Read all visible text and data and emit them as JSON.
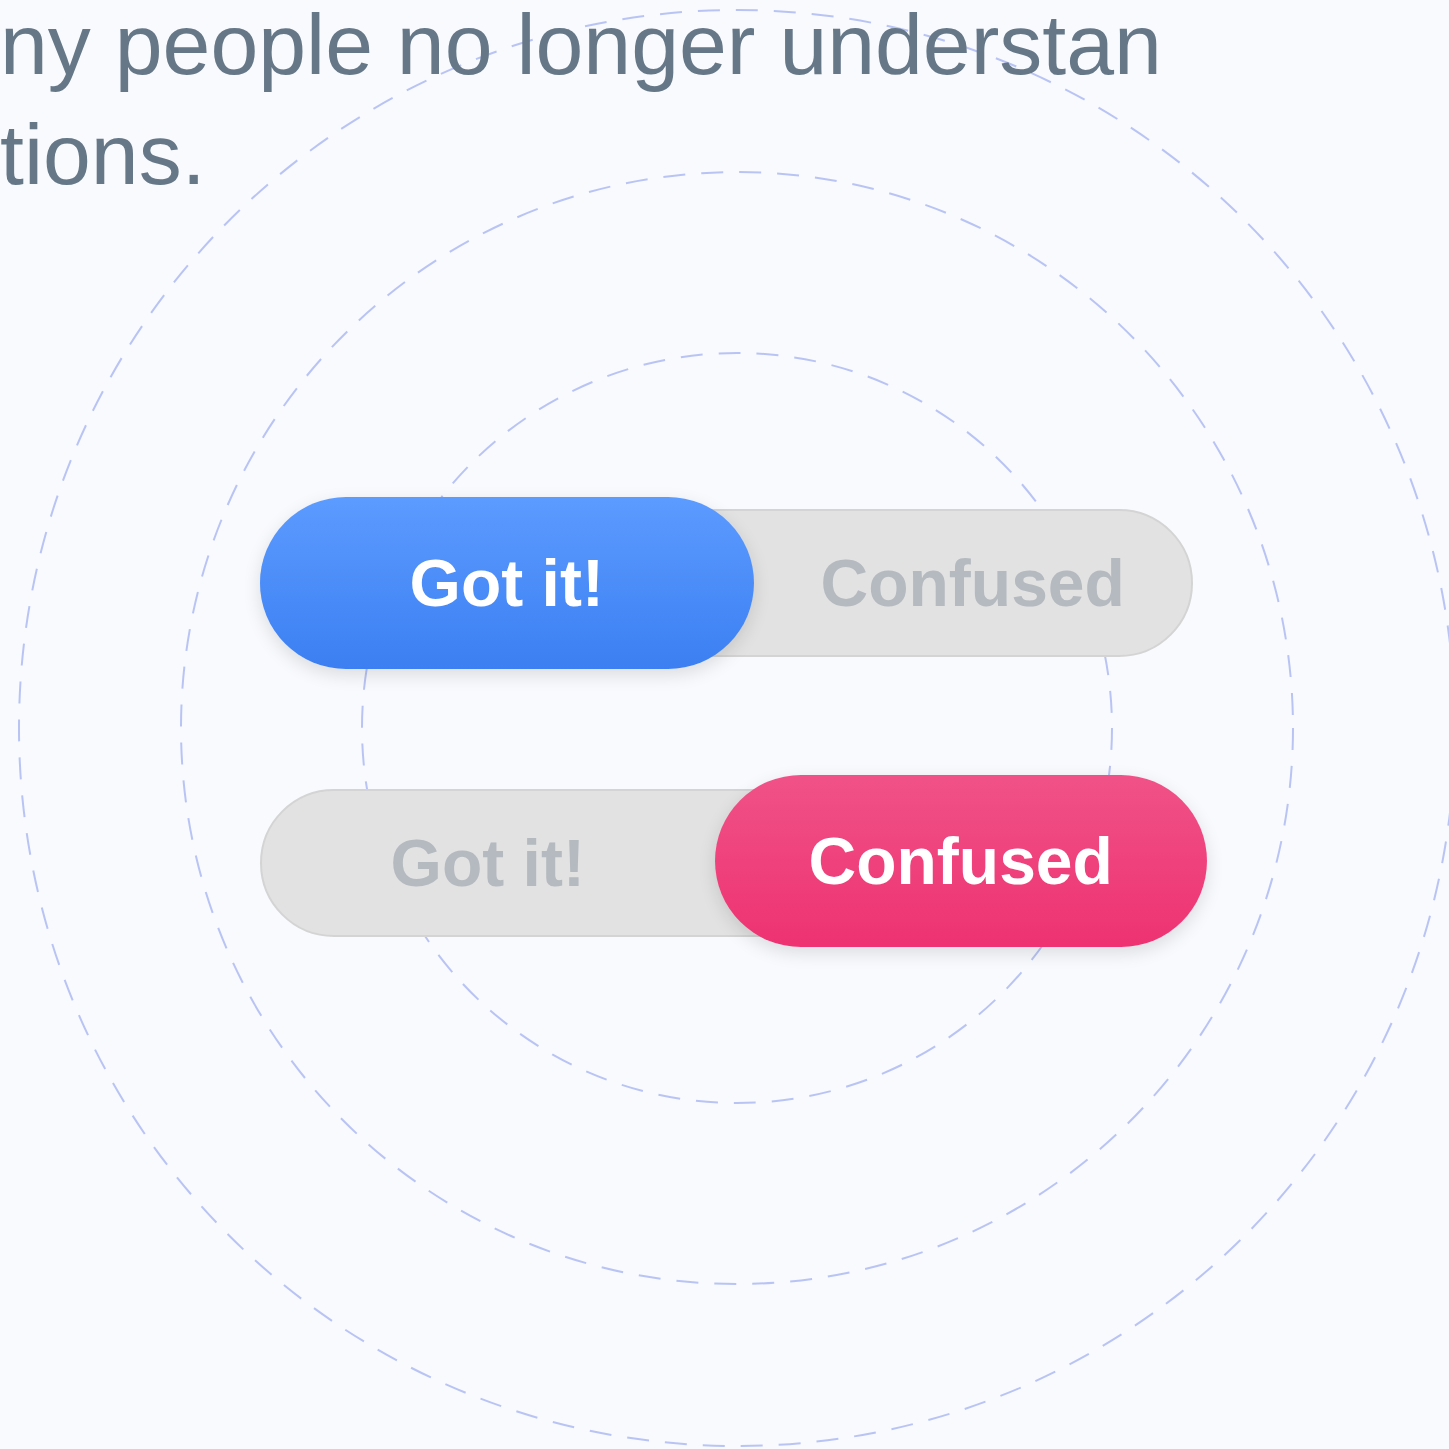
{
  "text_lines": [
    "ny people no longer understan",
    "tions."
  ],
  "toggles": [
    {
      "options": [
        {
          "label": "Got it!",
          "selected": true,
          "kind": "positive"
        },
        {
          "label": "Confused",
          "selected": false,
          "kind": "negative"
        }
      ]
    },
    {
      "options": [
        {
          "label": "Got it!",
          "selected": false,
          "kind": "positive"
        },
        {
          "label": "Confused",
          "selected": true,
          "kind": "negative"
        }
      ]
    }
  ]
}
